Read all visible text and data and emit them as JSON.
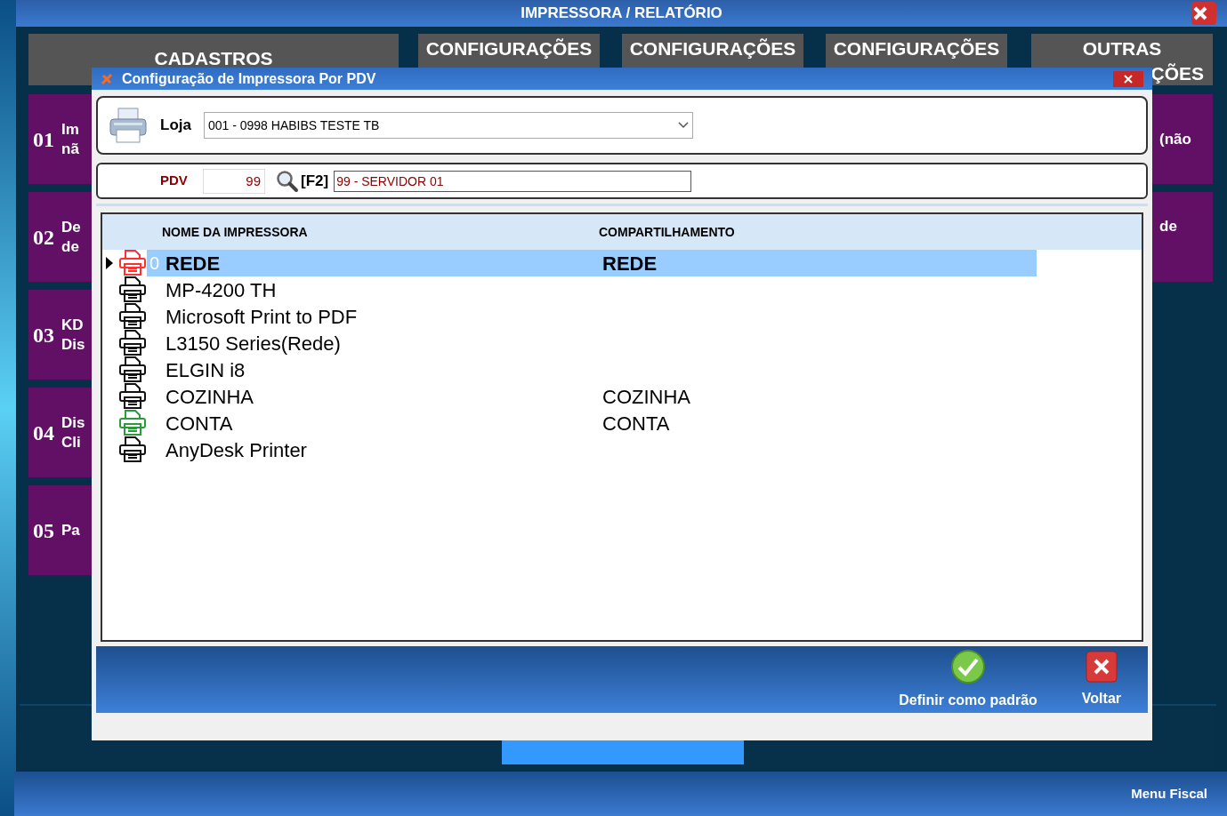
{
  "window": {
    "title": "IMPRESSORA / RELATÓRIO"
  },
  "tabs": [
    {
      "lines": [
        "CADASTROS"
      ]
    },
    {
      "lines": [
        "CONFIGURAÇÕES"
      ]
    },
    {
      "lines": [
        "CONFIGURAÇÕES"
      ]
    },
    {
      "lines": [
        "CONFIGURAÇÕES"
      ]
    },
    {
      "lines": [
        "OUTRAS",
        "ÇÕES"
      ]
    }
  ],
  "left_tiles": [
    {
      "number": "01",
      "lines": [
        "Im",
        "nã"
      ]
    },
    {
      "number": "02",
      "lines": [
        "De",
        "de"
      ]
    },
    {
      "number": "03",
      "lines": [
        "KD",
        "Dis"
      ]
    },
    {
      "number": "04",
      "lines": [
        "Dis",
        "Cli"
      ]
    },
    {
      "number": "05",
      "lines": [
        "Pa"
      ]
    }
  ],
  "right_tiles": [
    {
      "lines": [
        "(não"
      ]
    },
    {
      "lines": [
        "de"
      ]
    }
  ],
  "status_bar": {
    "text": "Menu Fiscal"
  },
  "dialog": {
    "title": "Configuração de Impressora Por PDV",
    "loja": {
      "label": "Loja",
      "value": "001 - 0998 HABIBS TESTE TB"
    },
    "pdv": {
      "label": "PDV",
      "value": "99",
      "shortcut": "[F2]",
      "description": "99 - SERVIDOR 01"
    },
    "table": {
      "columns": [
        "NOME DA IMPRESSORA",
        "COMPARTILHAMENTO"
      ],
      "rows": [
        {
          "name": "REDE",
          "sharing": "REDE",
          "code": "0",
          "color": "#ff3030",
          "selected": true
        },
        {
          "name": "MP-4200 TH",
          "color": "#111111",
          "selected": false
        },
        {
          "name": "Microsoft Print to PDF",
          "color": "#111111",
          "selected": false
        },
        {
          "name": "L3150 Series(Rede)",
          "color": "#111111",
          "selected": false
        },
        {
          "name": "ELGIN i8",
          "color": "#111111",
          "selected": false
        },
        {
          "name": "COZINHA",
          "sharing": "COZINHA",
          "color": "#111111",
          "selected": false
        },
        {
          "name": "CONTA",
          "sharing": "CONTA",
          "color": "#2a9a3a",
          "selected": false
        },
        {
          "name": "AnyDesk Printer",
          "color": "#111111",
          "selected": false
        }
      ]
    },
    "buttons": [
      {
        "kind": "confirm",
        "label": "Definir como padrão"
      },
      {
        "kind": "cancel",
        "label": "Voltar"
      }
    ]
  }
}
